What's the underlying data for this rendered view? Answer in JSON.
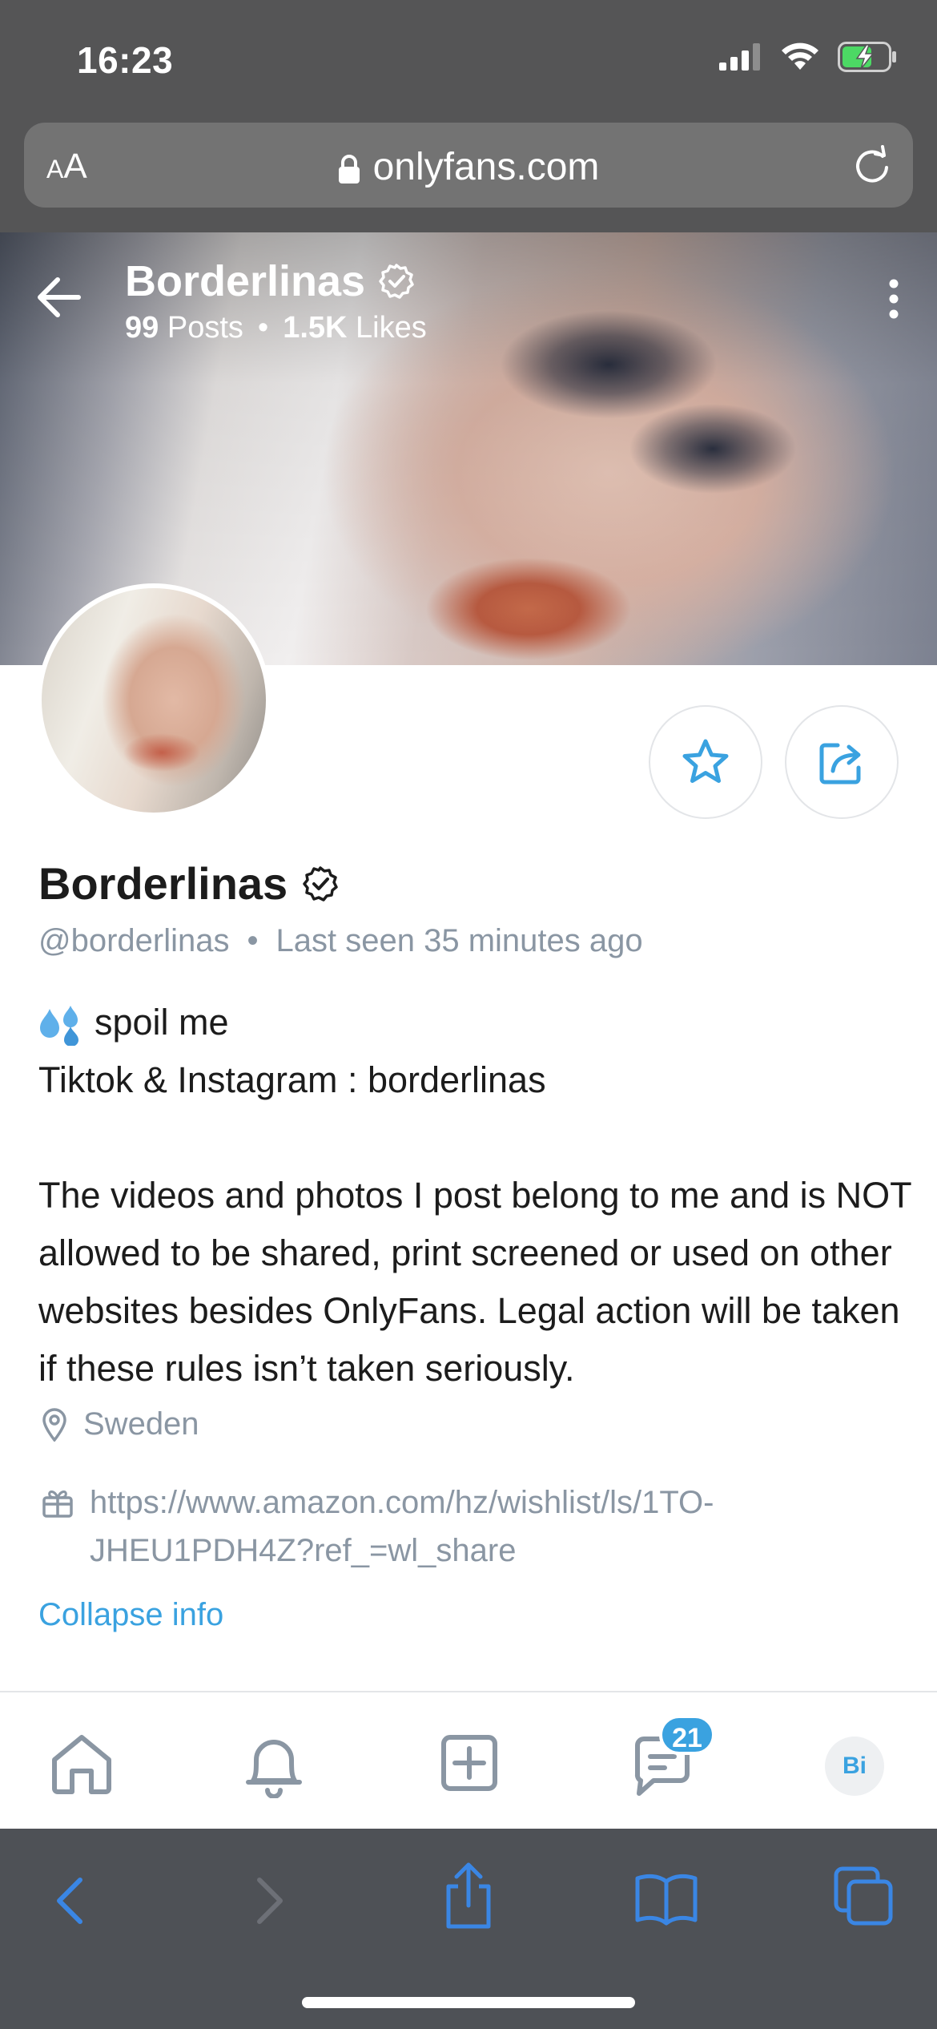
{
  "status": {
    "time": "16:23"
  },
  "browser": {
    "text_size_label_small": "A",
    "text_size_label_large": "A",
    "url": "onlyfans.com"
  },
  "cover": {
    "name": "Borderlinas",
    "posts_count": "99",
    "posts_label": "Posts",
    "likes_count": "1.5K",
    "likes_label": "Likes",
    "separator": "•"
  },
  "profile": {
    "name": "Borderlinas",
    "handle": "@borderlinas",
    "separator": "•",
    "last_seen": "Last seen 35 minutes ago",
    "bio_line1": "spoil me",
    "bio_line2": "Tiktok & Instagram : borderlinas",
    "bio_paragraph": "The videos and photos I post belong to me and is NOT allowed to be shared, print screened or used on other websites besides OnlyFans. Legal action will be taken if these rules isn’t taken seriously.",
    "location": "Sweden",
    "wishlist_url": "https://www.amazon.com/hz/wishlist/ls/1TO-JHEU1PDH4Z?ref_=wl_share",
    "collapse_label": "Collapse info"
  },
  "nav": {
    "messages_badge": "21",
    "avatar_initials": "Bi"
  },
  "colors": {
    "accent": "#3aa2e0",
    "muted": "#8a96a3",
    "status_bar": "#555556",
    "safari_toolbar": "#4e5156"
  }
}
